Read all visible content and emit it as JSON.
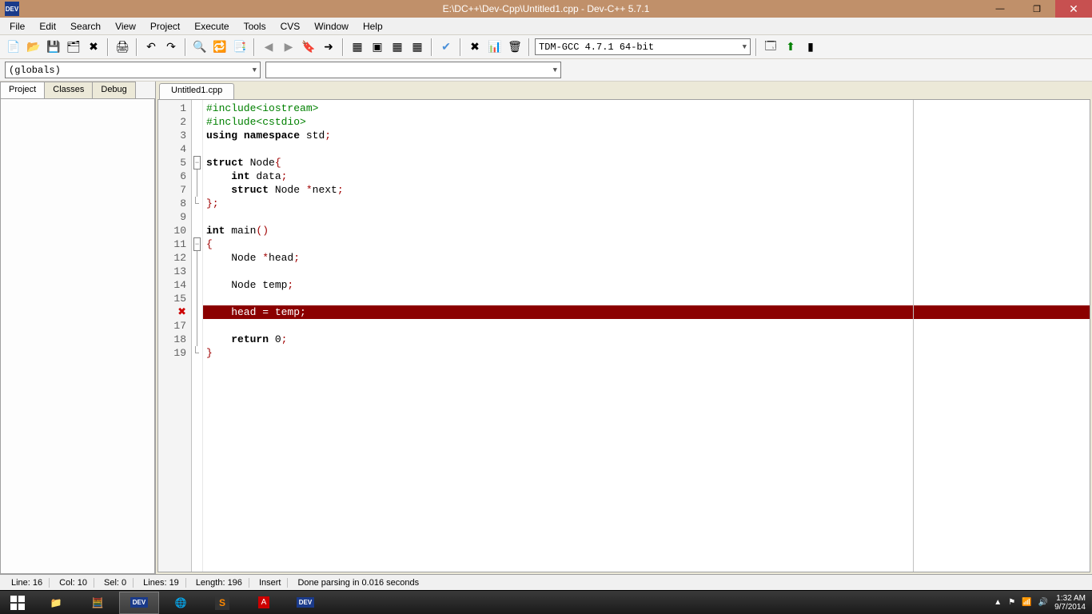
{
  "window": {
    "title": "E:\\DC++\\Dev-Cpp\\Untitled1.cpp - Dev-C++ 5.7.1"
  },
  "menu": [
    "File",
    "Edit",
    "Search",
    "View",
    "Project",
    "Execute",
    "Tools",
    "CVS",
    "Window",
    "Help"
  ],
  "scope_combo": "(globals)",
  "member_combo": "",
  "compiler_combo": "TDM-GCC 4.7.1 64-bit",
  "side_tabs": [
    "Project",
    "Classes",
    "Debug"
  ],
  "file_tab": "Untitled1.cpp",
  "code": {
    "lines": [
      {
        "n": "1",
        "fold": "",
        "html": "<span class='kw-green'>#include&lt;iostream&gt;</span>"
      },
      {
        "n": "2",
        "fold": "",
        "html": "<span class='kw-green'>#include&lt;cstdio&gt;</span>"
      },
      {
        "n": "3",
        "fold": "",
        "html": "<span class='kw-bold'>using</span> <span class='kw-bold'>namespace</span> std<span class='kw-red'>;</span>"
      },
      {
        "n": "4",
        "fold": "",
        "html": ""
      },
      {
        "n": "5",
        "fold": "box",
        "html": "<span class='kw-bold'>struct</span> Node<span class='kw-red'>{</span>"
      },
      {
        "n": "6",
        "fold": "line",
        "html": "    <span class='kw-bold'>int</span> data<span class='kw-red'>;</span>"
      },
      {
        "n": "7",
        "fold": "line",
        "html": "    <span class='kw-bold'>struct</span> Node <span class='kw-red'>*</span>next<span class='kw-red'>;</span>"
      },
      {
        "n": "8",
        "fold": "end",
        "html": "<span class='kw-red'>};</span>"
      },
      {
        "n": "9",
        "fold": "",
        "html": ""
      },
      {
        "n": "10",
        "fold": "",
        "html": "<span class='kw-bold'>int</span> main<span class='kw-red'>()</span>"
      },
      {
        "n": "11",
        "fold": "box",
        "html": "<span class='kw-red'>{</span>"
      },
      {
        "n": "12",
        "fold": "line",
        "html": "    Node <span class='kw-red'>*</span>head<span class='kw-red'>;</span>"
      },
      {
        "n": "13",
        "fold": "line",
        "html": ""
      },
      {
        "n": "14",
        "fold": "line",
        "html": "    Node temp<span class='kw-red'>;</span>"
      },
      {
        "n": "15",
        "fold": "line",
        "html": ""
      },
      {
        "n": "16",
        "fold": "line",
        "err": true,
        "html": "    head = temp;"
      },
      {
        "n": "17",
        "fold": "line",
        "html": ""
      },
      {
        "n": "18",
        "fold": "line",
        "html": "    <span class='kw-bold'>return</span> 0<span class='kw-red'>;</span>"
      },
      {
        "n": "19",
        "fold": "end",
        "html": "<span class='kw-red'>}</span>"
      }
    ]
  },
  "status": {
    "line": "Line:   16",
    "col": "Col:   10",
    "sel": "Sel:   0",
    "lines": "Lines:   19",
    "length": "Length:   196",
    "mode": "Insert",
    "msg": "Done parsing in 0.016 seconds"
  },
  "tray": {
    "time": "1:32 AM",
    "date": "9/7/2014"
  }
}
